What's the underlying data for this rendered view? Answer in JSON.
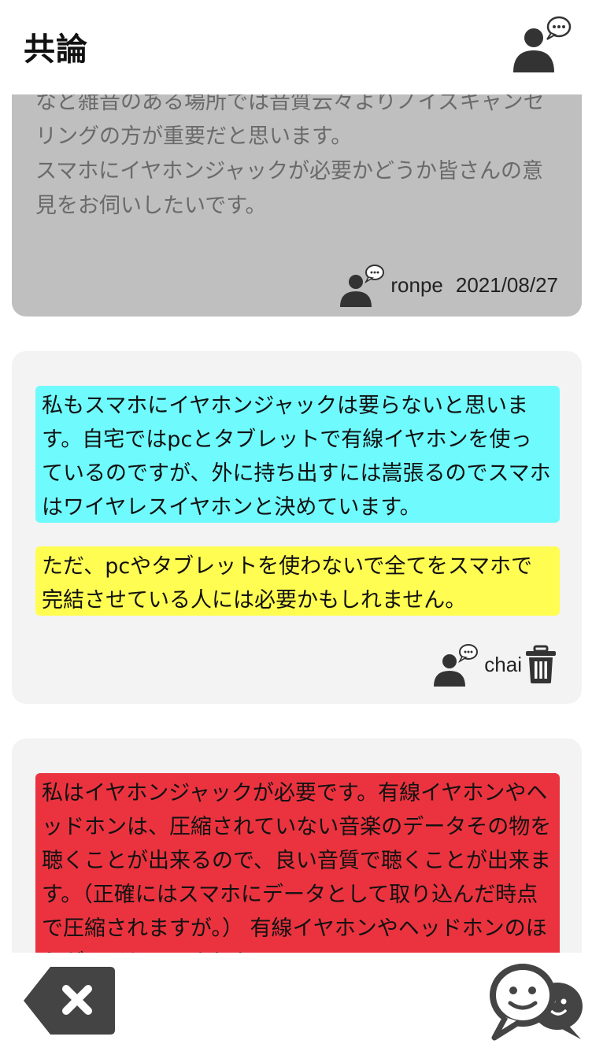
{
  "header": {
    "title": "共論"
  },
  "post": {
    "body": "など雑音のある場所では音質云々よりノイズキャンセリングの方が重要だと思います。\nスマホにイヤホンジャックが必要かどうか皆さんの意見をお伺いしたいです。",
    "author": "ronpe",
    "date": "2021/08/27"
  },
  "comments": [
    {
      "segments": [
        {
          "text": "私もスマホにイヤホンジャックは要らないと思います。自宅ではpcとタブレットで有線イヤホンを使っているのですが、外に持ち出すには嵩張るのでスマホはワイヤレスイヤホンと決めています。",
          "color": "#6ffbfd"
        },
        {
          "text": "ただ、pcやタブレットを使わないで全てをスマホで完結させている人には必要かもしれません。",
          "color": "#fffd51"
        }
      ],
      "author": "chai"
    },
    {
      "segments": [
        {
          "text": "私はイヤホンジャックが必要です。有線イヤホンやヘッドホンは、圧縮されていない音楽のデータその物を聴くことが出来るので、良い音質で聴くことが出来ます。（正確にはスマホにデータとして取り込んだ時点で圧縮されますが。） 有線イヤホンやヘッドホンのほうがワイヤレスよりも",
          "color": "#ea333f"
        }
      ]
    }
  ],
  "icons": {
    "profile": "user-chat-icon",
    "author": "user-chat-icon",
    "delete": "trash-icon",
    "back": "backspace-close-icon",
    "chat": "chat-bubbles-icon"
  }
}
